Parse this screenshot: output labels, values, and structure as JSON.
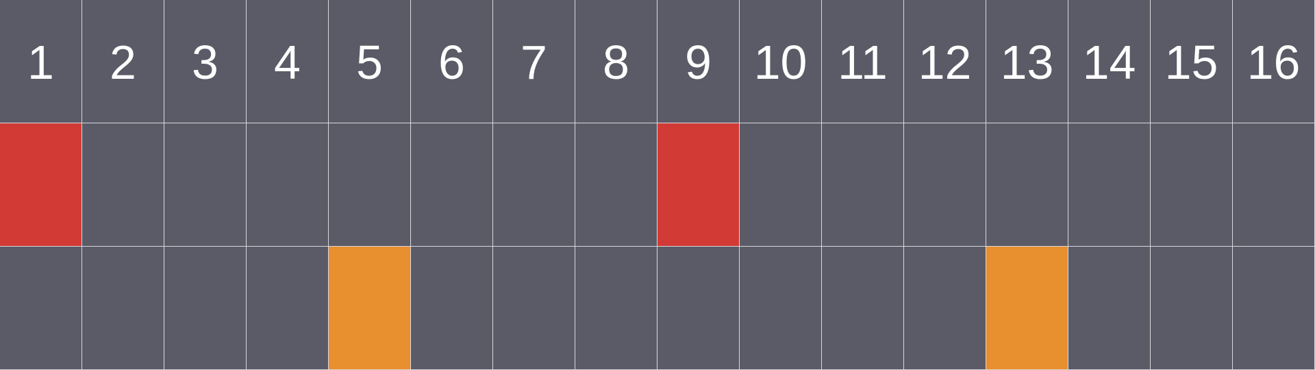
{
  "columns": [
    "1",
    "2",
    "3",
    "4",
    "5",
    "6",
    "7",
    "8",
    "9",
    "10",
    "11",
    "12",
    "13",
    "14",
    "15",
    "16"
  ],
  "colors": {
    "background": "#5b5b67",
    "grid_line": "#d9d9de",
    "header_text": "#ffffff",
    "row1_active": "#d13a35",
    "row2_active": "#e88f2f"
  },
  "rows": [
    {
      "active_steps": [
        1,
        9
      ]
    },
    {
      "active_steps": [
        5,
        13
      ]
    }
  ]
}
